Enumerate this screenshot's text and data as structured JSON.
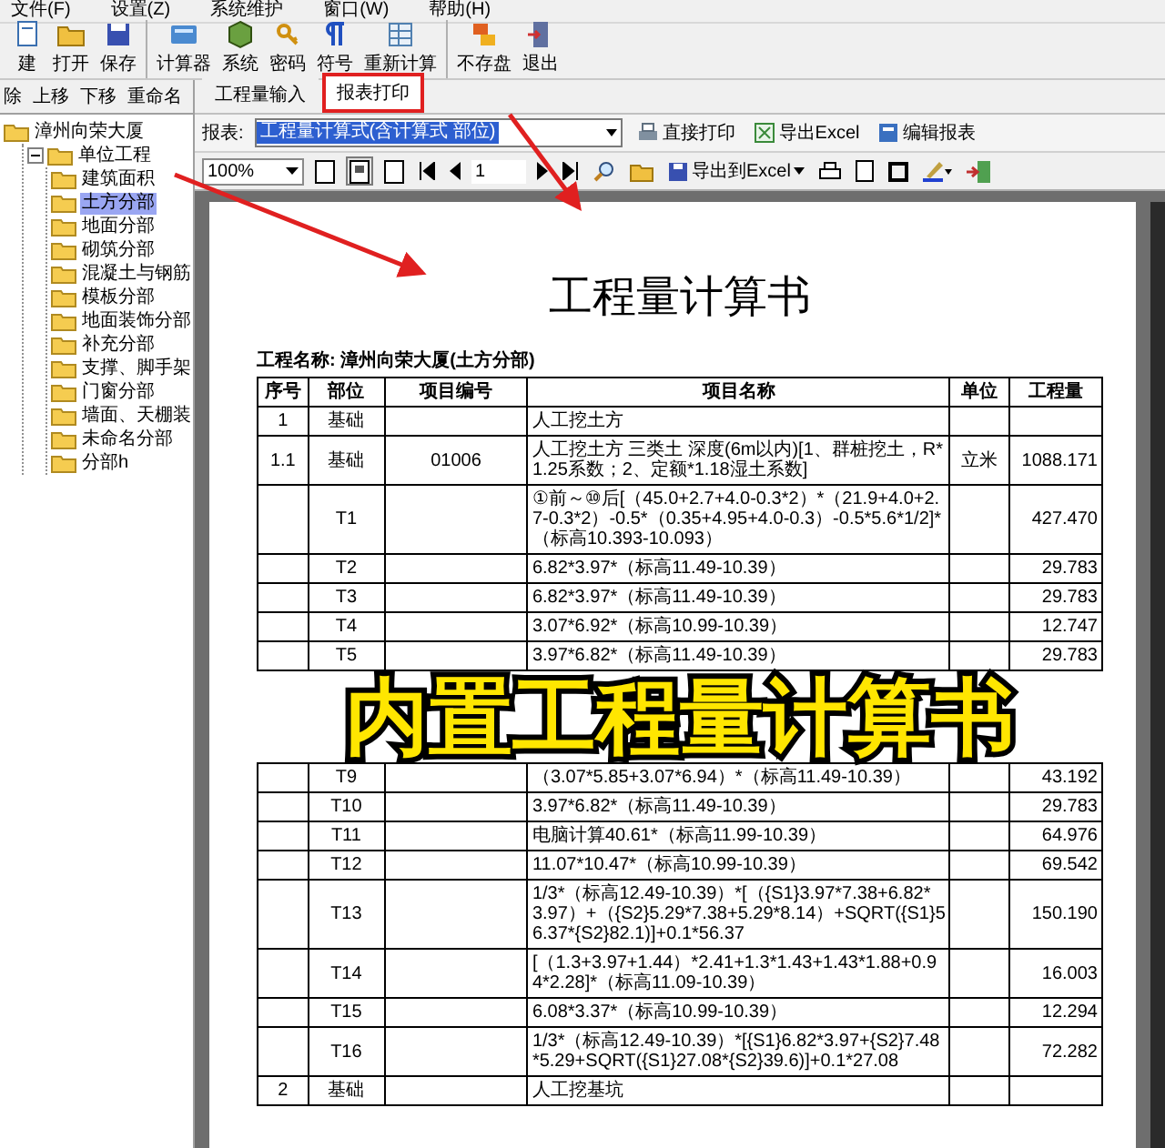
{
  "menu": [
    "文件(F)",
    "设置(Z)",
    "系统维护",
    "窗口(W)",
    "帮助(H)"
  ],
  "toolbar": [
    [
      "建",
      "打开",
      "保存"
    ],
    [
      "计算器",
      "系统",
      "密码",
      "符号",
      "重新计算"
    ],
    [
      "不存盘",
      "退出"
    ]
  ],
  "tree_actions": [
    "除",
    "上移",
    "下移",
    "重命名"
  ],
  "tree": [
    {
      "label": "漳州向荣大厦",
      "selected": false,
      "children": [
        {
          "label": "单位工程",
          "selected": false,
          "expanded": true,
          "children": [
            {
              "label": "建筑面积",
              "selected": false
            },
            {
              "label": "土方分部",
              "selected": true
            },
            {
              "label": "地面分部",
              "selected": false
            },
            {
              "label": "砌筑分部",
              "selected": false
            },
            {
              "label": "混凝土与钢筋",
              "selected": false
            },
            {
              "label": "模板分部",
              "selected": false
            },
            {
              "label": "地面装饰分部",
              "selected": false
            },
            {
              "label": "补充分部",
              "selected": false
            },
            {
              "label": "支撑、脚手架",
              "selected": false
            },
            {
              "label": "门窗分部",
              "selected": false
            },
            {
              "label": "墙面、天棚装",
              "selected": false
            },
            {
              "label": "未命名分部",
              "selected": false
            },
            {
              "label": "分部h",
              "selected": false
            }
          ]
        }
      ]
    }
  ],
  "tabs": [
    {
      "label": "工程量输入",
      "selected": false,
      "highlighted": false
    },
    {
      "label": "报表打印",
      "selected": true,
      "highlighted": true
    }
  ],
  "report_bar": {
    "label": "报表:",
    "value": "工程量计算式(含计算式 部位)",
    "buttons": [
      "直接打印",
      "导出Excel",
      "编辑报表"
    ]
  },
  "preview_toolbar": {
    "zoom": "100%",
    "page": "1",
    "export": "导出到Excel"
  },
  "document": {
    "title": "工程量计算书",
    "project": "工程名称: 漳州向荣大厦(土方分部)",
    "columns": [
      "序号",
      "部位",
      "项目编号",
      "项目名称",
      "单位",
      "工程量"
    ],
    "rows": [
      {
        "no": "1",
        "part": "基础",
        "name": "人工挖土方"
      },
      {
        "no": "1.1",
        "part": "基础",
        "code": "01006",
        "name": "人工挖土方 三类土 深度(6m以内)[1、群桩挖土，R*1.25系数；2、定额*1.18湿土系数]",
        "unit": "立米",
        "qty": "1088.171"
      },
      {
        "part": "T1",
        "name": "①前～⑩后[（45.0+2.7+4.0-0.3*2）*（21.9+4.0+2.7-0.3*2）-0.5*（0.35+4.95+4.0-0.3）-0.5*5.6*1/2]*（标高10.393-10.093）",
        "qty": "427.470"
      },
      {
        "part": "T2",
        "name": "6.82*3.97*（标高11.49-10.39）",
        "qty": "29.783"
      },
      {
        "part": "T3",
        "name": "6.82*3.97*（标高11.49-10.39）",
        "qty": "29.783"
      },
      {
        "part": "T4",
        "name": "3.07*6.92*（标高10.99-10.39）",
        "qty": "12.747"
      },
      {
        "part": "T5",
        "name": "3.97*6.82*（标高11.49-10.39）",
        "qty": "29.783"
      }
    ],
    "rows_after": [
      {
        "part": "T9",
        "name": "（3.07*5.85+3.07*6.94）*（标高11.49-10.39）",
        "qty": "43.192"
      },
      {
        "part": "T10",
        "name": "3.97*6.82*（标高11.49-10.39）",
        "qty": "29.783"
      },
      {
        "part": "T11",
        "name": "电脑计算40.61*（标高11.99-10.39）",
        "qty": "64.976"
      },
      {
        "part": "T12",
        "name": "11.07*10.47*（标高10.99-10.39）",
        "qty": "69.542"
      },
      {
        "part": "T13",
        "name": "1/3*（标高12.49-10.39）*[（{S1}3.97*7.38+6.82*3.97）+（{S2}5.29*7.38+5.29*8.14）+SQRT({S1}56.37*{S2}82.1)]+0.1*56.37",
        "qty": "150.190"
      },
      {
        "part": "T14",
        "name": "[（1.3+3.97+1.44）*2.41+1.3*1.43+1.43*1.88+0.94*2.28]*（标高11.09-10.39）",
        "qty": "16.003"
      },
      {
        "part": "T15",
        "name": "6.08*3.37*（标高10.99-10.39）",
        "qty": "12.294"
      },
      {
        "part": "T16",
        "name": "1/3*（标高12.49-10.39）*[{S1}6.82*3.97+{S2}7.48*5.29+SQRT({S1}27.08*{S2}39.6)]+0.1*27.08",
        "qty": "72.282"
      },
      {
        "no": "2",
        "part": "基础",
        "name": "人工挖基坑"
      }
    ]
  },
  "caption": "内置工程量计算书"
}
